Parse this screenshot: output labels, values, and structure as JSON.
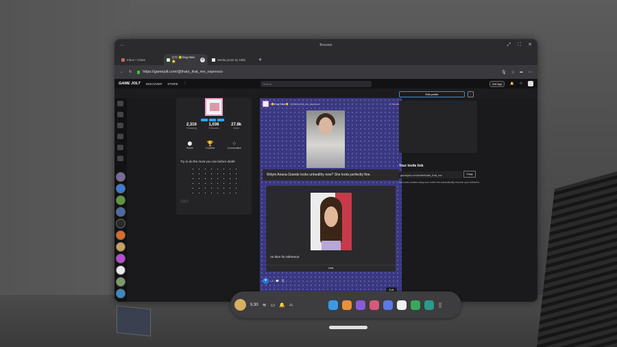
{
  "window": {
    "title": "Browser",
    "controls": [
      "⤢",
      "⛶",
      "✕"
    ]
  },
  "tabs": [
    {
      "label": "Inbox • Chats"
    },
    {
      "label": "(17) 🌟Dog Man🌟"
    },
    {
      "label": "Media posts by Nikki"
    }
  ],
  "addressbar": {
    "url": "https://gamejolt.com/@thats_that_me_espresso",
    "get_app": "Get App"
  },
  "gamejolt": {
    "logo": "GAME JOLT",
    "nav": [
      "DISCOVER",
      "STORE"
    ],
    "search_placeholder": "Search"
  },
  "profile": {
    "stats": [
      {
        "value": "2,316",
        "label": "Following"
      },
      {
        "value": "1,036",
        "label": "Followers"
      },
      {
        "value": "27.8k",
        "label": "Likes"
      }
    ],
    "buttons": [
      {
        "icon": "shell-icon",
        "glyph": "⬢",
        "label": "Shells"
      },
      {
        "icon": "trophy-icon",
        "glyph": "🏆",
        "label": "Trophies"
      },
      {
        "icon": "communities-icon",
        "glyph": "⁘",
        "label": "Communities"
      }
    ],
    "bio": "Try to do the most you can before death",
    "more_button": "..."
  },
  "post": {
    "author": "🌟Dog Man🌟",
    "handle": "@thats_that_me_espresso",
    "time": "5 hours",
    "caption": "Wdym Ariana Grande looks unhealthy now? She looks perfectly fine.",
    "reply_text": "As then for reference:",
    "less": "Less",
    "like_count": "2",
    "views": "11 views",
    "edit": "Edit"
  },
  "right": {
    "edit_profile": "Edit profile",
    "more": "⋮",
    "invite_title": "Your invite link",
    "invite_url": "gamejolt.com/invite/thats_that_me",
    "copy": "Copy",
    "invite_note": "Accounts created using your invite link automatically become your followers."
  },
  "taskbar": {
    "time": "5:30"
  }
}
